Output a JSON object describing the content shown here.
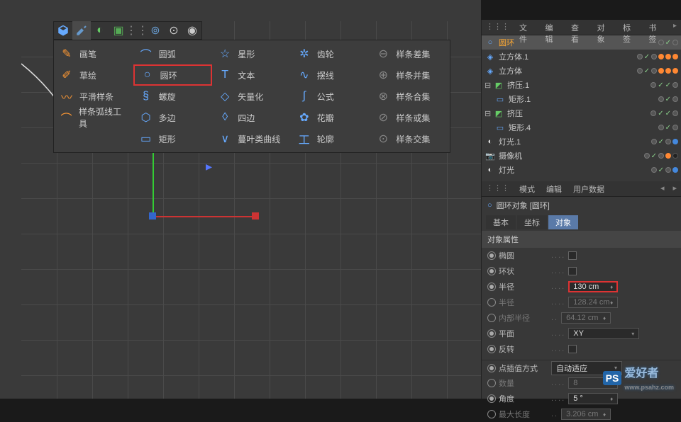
{
  "toolbar": {
    "icons": [
      "cube",
      "pen",
      "deform1",
      "deform2",
      "array",
      "metaball",
      "gear",
      "sphere"
    ]
  },
  "spline_menu": {
    "col1": [
      {
        "icon": "pen-orange",
        "label": "画笔"
      },
      {
        "icon": "sketch-orange",
        "label": "草绘"
      },
      {
        "icon": "smooth-orange",
        "label": "平滑样条"
      },
      {
        "icon": "arc-tool-orange",
        "label": "样条弧线工具"
      }
    ],
    "col2": [
      {
        "icon": "arc",
        "label": "圆弧"
      },
      {
        "icon": "circle",
        "label": "圆环",
        "highlight": true
      },
      {
        "icon": "helix",
        "label": "螺旋"
      },
      {
        "icon": "poly",
        "label": "多边"
      },
      {
        "icon": "rect",
        "label": "矩形"
      }
    ],
    "col3": [
      {
        "icon": "star",
        "label": "星形"
      },
      {
        "icon": "text",
        "label": "文本"
      },
      {
        "icon": "vector",
        "label": "矢量化"
      },
      {
        "icon": "quad",
        "label": "四边"
      },
      {
        "icon": "leaf",
        "label": "蔓叶类曲线"
      }
    ],
    "col4": [
      {
        "icon": "gear",
        "label": "齿轮"
      },
      {
        "icon": "cycloid",
        "label": "摆线"
      },
      {
        "icon": "formula",
        "label": "公式"
      },
      {
        "icon": "flower",
        "label": "花瓣"
      },
      {
        "icon": "profile",
        "label": "轮廓"
      }
    ],
    "col5": [
      {
        "icon": "mask",
        "label": "样条差集"
      },
      {
        "icon": "union",
        "label": "样条并集"
      },
      {
        "icon": "combine",
        "label": "样条合集"
      },
      {
        "icon": "or",
        "label": "样条或集"
      },
      {
        "icon": "intersect",
        "label": "样条交集"
      }
    ]
  },
  "obj_manager": {
    "tabs": [
      "文件",
      "编辑",
      "查看",
      "对象",
      "标签",
      "书签"
    ],
    "items": [
      {
        "icon": "circle",
        "name": "圆环",
        "selected": true,
        "depth": 0,
        "dots": [
          "g",
          "g"
        ],
        "checks": 1
      },
      {
        "icon": "cube",
        "name": "立方体.1",
        "depth": 0,
        "dots": [
          "g",
          "g",
          "or",
          "or",
          "or"
        ],
        "checks": 1
      },
      {
        "icon": "cube",
        "name": "立方体",
        "depth": 0,
        "dots": [
          "g",
          "g",
          "or",
          "or",
          "or"
        ],
        "checks": 1
      },
      {
        "icon": "extrude",
        "name": "挤压.1",
        "depth": 0,
        "expand": "-",
        "dots": [
          "g",
          "g"
        ],
        "checks": 2
      },
      {
        "icon": "rect",
        "name": "矩形.1",
        "depth": 1,
        "dots": [
          "g",
          "g"
        ],
        "checks": 1
      },
      {
        "icon": "extrude",
        "name": "挤压",
        "depth": 0,
        "expand": "-",
        "dots": [
          "g",
          "g"
        ],
        "checks": 2
      },
      {
        "icon": "rect",
        "name": "矩形.4",
        "depth": 1,
        "dots": [
          "g",
          "g"
        ],
        "checks": 1
      },
      {
        "icon": "light",
        "name": "灯光.1",
        "depth": 0,
        "dots": [
          "g",
          "g",
          "bl"
        ],
        "checks": 1
      },
      {
        "icon": "camera",
        "name": "摄像机",
        "depth": 0,
        "dots": [
          "g",
          "g",
          "or",
          "bk"
        ],
        "checks": 1
      },
      {
        "icon": "light",
        "name": "灯光",
        "depth": 0,
        "dots": [
          "g",
          "g",
          "bl"
        ],
        "checks": 1
      }
    ]
  },
  "attributes": {
    "mode_tabs": [
      "模式",
      "编辑",
      "用户数据"
    ],
    "title": "圆环对象 [圆环]",
    "sub_tabs": [
      "基本",
      "坐标",
      "对象"
    ],
    "section": "对象属性",
    "rows": [
      {
        "label": "椭圆",
        "type": "check",
        "value": false
      },
      {
        "label": "环状",
        "type": "check",
        "value": false
      },
      {
        "label": "半径",
        "type": "input",
        "value": "130 cm",
        "highlight": true
      },
      {
        "label": "半径",
        "type": "input",
        "value": "128.24 cm",
        "disabled": true
      },
      {
        "label": "内部半径",
        "type": "input",
        "value": "64.12 cm",
        "disabled": true
      },
      {
        "label": "平面",
        "type": "input",
        "value": "XY"
      },
      {
        "label": "反转",
        "type": "check",
        "value": false
      }
    ],
    "section2": "点插值方式",
    "section2_value": "自动适应",
    "rows2": [
      {
        "label": "数量",
        "type": "input",
        "value": "8",
        "disabled": true
      },
      {
        "label": "角度",
        "type": "input",
        "value": "5 °"
      },
      {
        "label": "最大长度",
        "type": "input",
        "value": "3.206 cm",
        "disabled": true
      }
    ]
  },
  "watermark": {
    "brand": "PS",
    "text": "爱好者",
    "url": "www.psahz.com"
  }
}
